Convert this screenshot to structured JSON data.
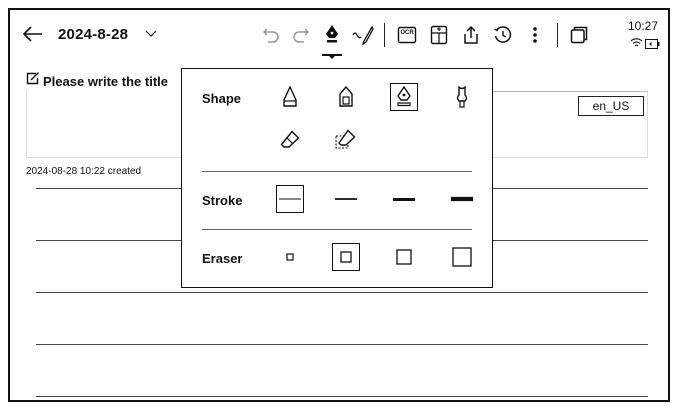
{
  "header": {
    "date": "2024-8-28",
    "icons": {
      "back": "arrow-left-icon",
      "date_dropdown": "chevron-down-icon",
      "undo": "undo-icon",
      "redo": "redo-icon",
      "pen": "fountain-pen-icon",
      "stylus": "stylus-icon",
      "ocr": "ocr-icon",
      "ocr_text": "OCR",
      "template": "template-icon",
      "share": "share-icon",
      "history": "history-icon",
      "more": "more-vertical-icon",
      "window": "window-icon"
    },
    "status": {
      "time": "10:27",
      "wifi": "wifi-icon",
      "battery": "battery-icon"
    }
  },
  "note": {
    "title_placeholder": "Please write the title",
    "language": "en_US",
    "created": "2024-08-28 10:22 created"
  },
  "popup": {
    "shape": {
      "label": "Shape",
      "options": [
        "pencil-icon",
        "marker-icon",
        "fountain-pen-icon",
        "brush-icon",
        "eraser-icon",
        "area-eraser-icon"
      ],
      "selected_index": 2
    },
    "stroke": {
      "label": "Stroke",
      "options": [
        "thin",
        "medium",
        "thick",
        "extra-thick"
      ],
      "selected_index": 0
    },
    "eraser": {
      "label": "Eraser",
      "options": [
        "extra-small",
        "small",
        "medium",
        "large"
      ],
      "selected_index": 1
    }
  },
  "colors": {
    "ink": "#111111",
    "rule": "#444444"
  }
}
